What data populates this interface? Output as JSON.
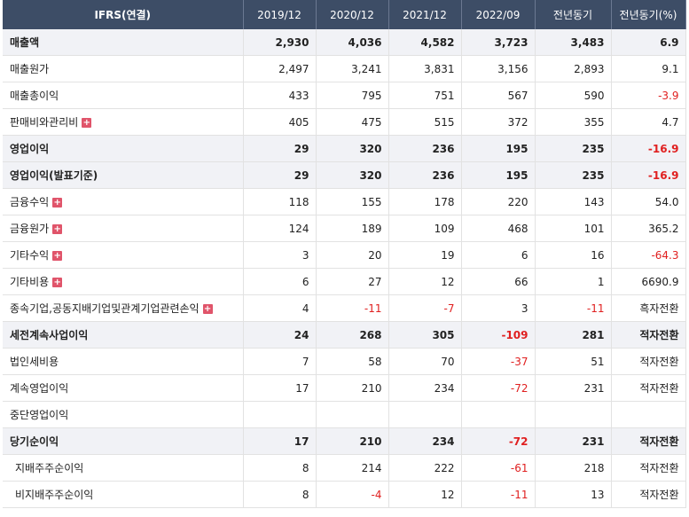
{
  "header": [
    "IFRS(연결)",
    "2019/12",
    "2020/12",
    "2021/12",
    "2022/09",
    "전년동기",
    "전년동기(%)"
  ],
  "rows": [
    {
      "label": "매출액",
      "bold": true,
      "plus": false,
      "indent": false,
      "values": [
        "2,930",
        "4,036",
        "4,582",
        "3,723",
        "3,483",
        "6.9"
      ],
      "neg": [
        false,
        false,
        false,
        false,
        false,
        false
      ]
    },
    {
      "label": "매출원가",
      "bold": false,
      "plus": false,
      "indent": false,
      "values": [
        "2,497",
        "3,241",
        "3,831",
        "3,156",
        "2,893",
        "9.1"
      ],
      "neg": [
        false,
        false,
        false,
        false,
        false,
        false
      ]
    },
    {
      "label": "매출총이익",
      "bold": false,
      "plus": false,
      "indent": false,
      "values": [
        "433",
        "795",
        "751",
        "567",
        "590",
        "-3.9"
      ],
      "neg": [
        false,
        false,
        false,
        false,
        false,
        true
      ]
    },
    {
      "label": "판매비와관리비",
      "bold": false,
      "plus": true,
      "indent": false,
      "values": [
        "405",
        "475",
        "515",
        "372",
        "355",
        "4.7"
      ],
      "neg": [
        false,
        false,
        false,
        false,
        false,
        false
      ]
    },
    {
      "label": "영업이익",
      "bold": true,
      "plus": false,
      "indent": false,
      "values": [
        "29",
        "320",
        "236",
        "195",
        "235",
        "-16.9"
      ],
      "neg": [
        false,
        false,
        false,
        false,
        false,
        true
      ]
    },
    {
      "label": "영업이익(발표기준)",
      "bold": true,
      "plus": false,
      "indent": false,
      "values": [
        "29",
        "320",
        "236",
        "195",
        "235",
        "-16.9"
      ],
      "neg": [
        false,
        false,
        false,
        false,
        false,
        true
      ]
    },
    {
      "label": "금융수익",
      "bold": false,
      "plus": true,
      "indent": false,
      "values": [
        "118",
        "155",
        "178",
        "220",
        "143",
        "54.0"
      ],
      "neg": [
        false,
        false,
        false,
        false,
        false,
        false
      ]
    },
    {
      "label": "금융원가",
      "bold": false,
      "plus": true,
      "indent": false,
      "values": [
        "124",
        "189",
        "109",
        "468",
        "101",
        "365.2"
      ],
      "neg": [
        false,
        false,
        false,
        false,
        false,
        false
      ]
    },
    {
      "label": "기타수익",
      "bold": false,
      "plus": true,
      "indent": false,
      "values": [
        "3",
        "20",
        "19",
        "6",
        "16",
        "-64.3"
      ],
      "neg": [
        false,
        false,
        false,
        false,
        false,
        true
      ]
    },
    {
      "label": "기타비용",
      "bold": false,
      "plus": true,
      "indent": false,
      "values": [
        "6",
        "27",
        "12",
        "66",
        "1",
        "6690.9"
      ],
      "neg": [
        false,
        false,
        false,
        false,
        false,
        false
      ]
    },
    {
      "label": "종속기업,공동지배기업및관계기업관련손익",
      "bold": false,
      "plus": true,
      "indent": false,
      "values": [
        "4",
        "-11",
        "-7",
        "3",
        "-11",
        "흑자전환"
      ],
      "neg": [
        false,
        true,
        true,
        false,
        true,
        false
      ]
    },
    {
      "label": "세전계속사업이익",
      "bold": true,
      "plus": false,
      "indent": false,
      "values": [
        "24",
        "268",
        "305",
        "-109",
        "281",
        "적자전환"
      ],
      "neg": [
        false,
        false,
        false,
        true,
        false,
        false
      ]
    },
    {
      "label": "법인세비용",
      "bold": false,
      "plus": false,
      "indent": false,
      "values": [
        "7",
        "58",
        "70",
        "-37",
        "51",
        "적자전환"
      ],
      "neg": [
        false,
        false,
        false,
        true,
        false,
        false
      ]
    },
    {
      "label": "계속영업이익",
      "bold": false,
      "plus": false,
      "indent": false,
      "values": [
        "17",
        "210",
        "234",
        "-72",
        "231",
        "적자전환"
      ],
      "neg": [
        false,
        false,
        false,
        true,
        false,
        false
      ]
    },
    {
      "label": "중단영업이익",
      "bold": false,
      "plus": false,
      "indent": false,
      "values": [
        "",
        "",
        "",
        "",
        "",
        ""
      ],
      "neg": [
        false,
        false,
        false,
        false,
        false,
        false
      ]
    },
    {
      "label": "당기순이익",
      "bold": true,
      "plus": false,
      "indent": false,
      "values": [
        "17",
        "210",
        "234",
        "-72",
        "231",
        "적자전환"
      ],
      "neg": [
        false,
        false,
        false,
        true,
        false,
        false
      ]
    },
    {
      "label": "지배주주순이익",
      "bold": false,
      "plus": false,
      "indent": true,
      "values": [
        "8",
        "214",
        "222",
        "-61",
        "218",
        "적자전환"
      ],
      "neg": [
        false,
        false,
        false,
        true,
        false,
        false
      ]
    },
    {
      "label": "비지배주주순이익",
      "bold": false,
      "plus": false,
      "indent": true,
      "values": [
        "8",
        "-4",
        "12",
        "-11",
        "13",
        "적자전환"
      ],
      "neg": [
        false,
        true,
        false,
        true,
        false,
        false
      ]
    }
  ]
}
